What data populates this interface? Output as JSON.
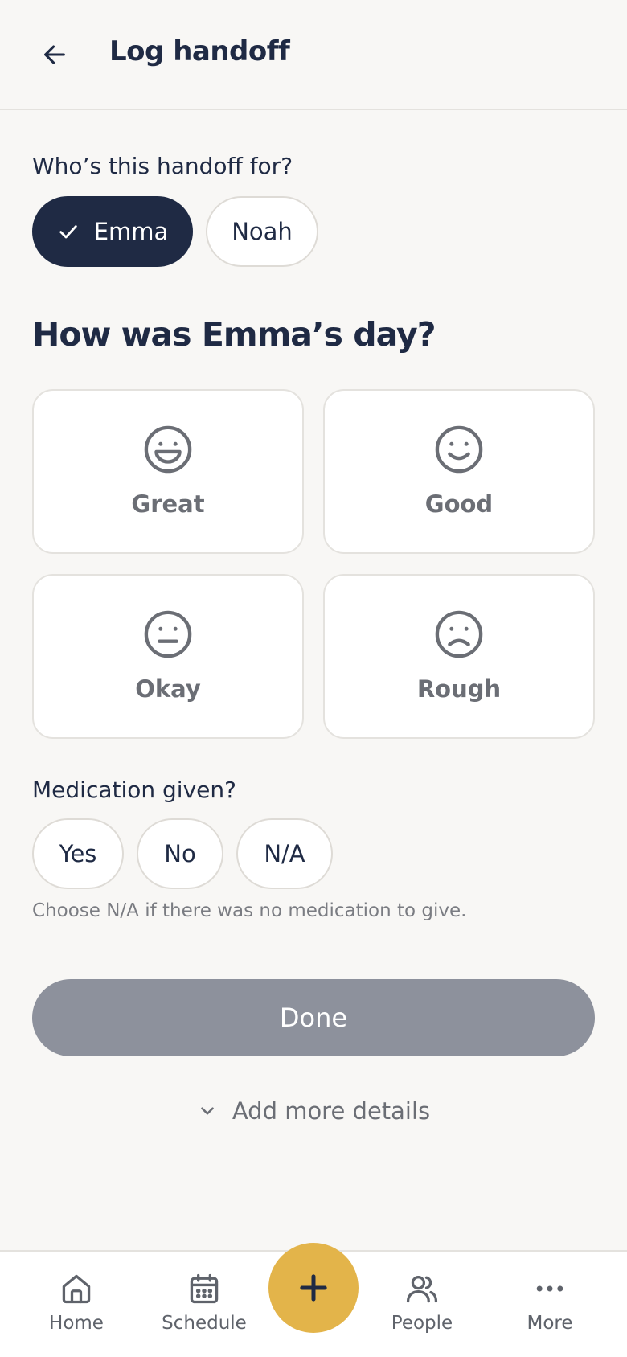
{
  "header": {
    "title": "Log handoff",
    "back_icon": "arrow-left-icon"
  },
  "recipient": {
    "label": "Who’s this handoff for?",
    "options": [
      {
        "label": "Emma",
        "selected": true
      },
      {
        "label": "Noah",
        "selected": false
      }
    ]
  },
  "mood": {
    "question": "How was Emma’s day?",
    "options": [
      {
        "label": "Great",
        "icon": "grin-face-icon"
      },
      {
        "label": "Good",
        "icon": "smile-face-icon"
      },
      {
        "label": "Okay",
        "icon": "neutral-face-icon"
      },
      {
        "label": "Rough",
        "icon": "frown-face-icon"
      }
    ]
  },
  "medication": {
    "label": "Medication given?",
    "options": [
      "Yes",
      "No",
      "N/A"
    ],
    "hint": "Choose N/A if there was no medication to give."
  },
  "actions": {
    "done_label": "Done",
    "more_details_label": "Add more details"
  },
  "nav": {
    "items": [
      {
        "label": "Home",
        "icon": "home-icon"
      },
      {
        "label": "Schedule",
        "icon": "calendar-icon"
      },
      {
        "label": "People",
        "icon": "people-icon"
      },
      {
        "label": "More",
        "icon": "more-dots-icon"
      }
    ],
    "fab_icon": "plus-icon"
  },
  "colors": {
    "primary_navy": "#1f2a44",
    "accent_yellow": "#e3b44a",
    "disabled_gray": "#8d919c",
    "background": "#f8f7f5"
  }
}
